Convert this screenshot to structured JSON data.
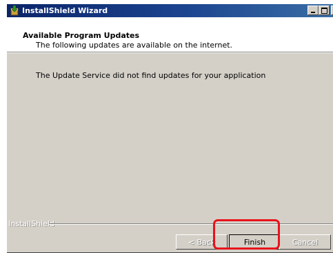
{
  "window": {
    "title": "InstallShield Wizard",
    "icon": "installer-box-icon"
  },
  "title_buttons": {
    "minimize_icon": "minimize-icon",
    "maximize_icon": "maximize-icon",
    "close_glyph": "×"
  },
  "header": {
    "title": "Available Program Updates",
    "subtitle": "The following updates are available on the internet."
  },
  "body": {
    "message": "The Update Service did not find updates for your application"
  },
  "footer": {
    "brand": "InstallShield"
  },
  "buttons": {
    "back": "< Back",
    "finish": "Finish",
    "cancel": "Cancel"
  },
  "colors": {
    "titlebar_start": "#0a246a",
    "titlebar_end": "#3a6ea5",
    "dialog_face": "#d4d0c8",
    "highlight": "#e8121c"
  }
}
